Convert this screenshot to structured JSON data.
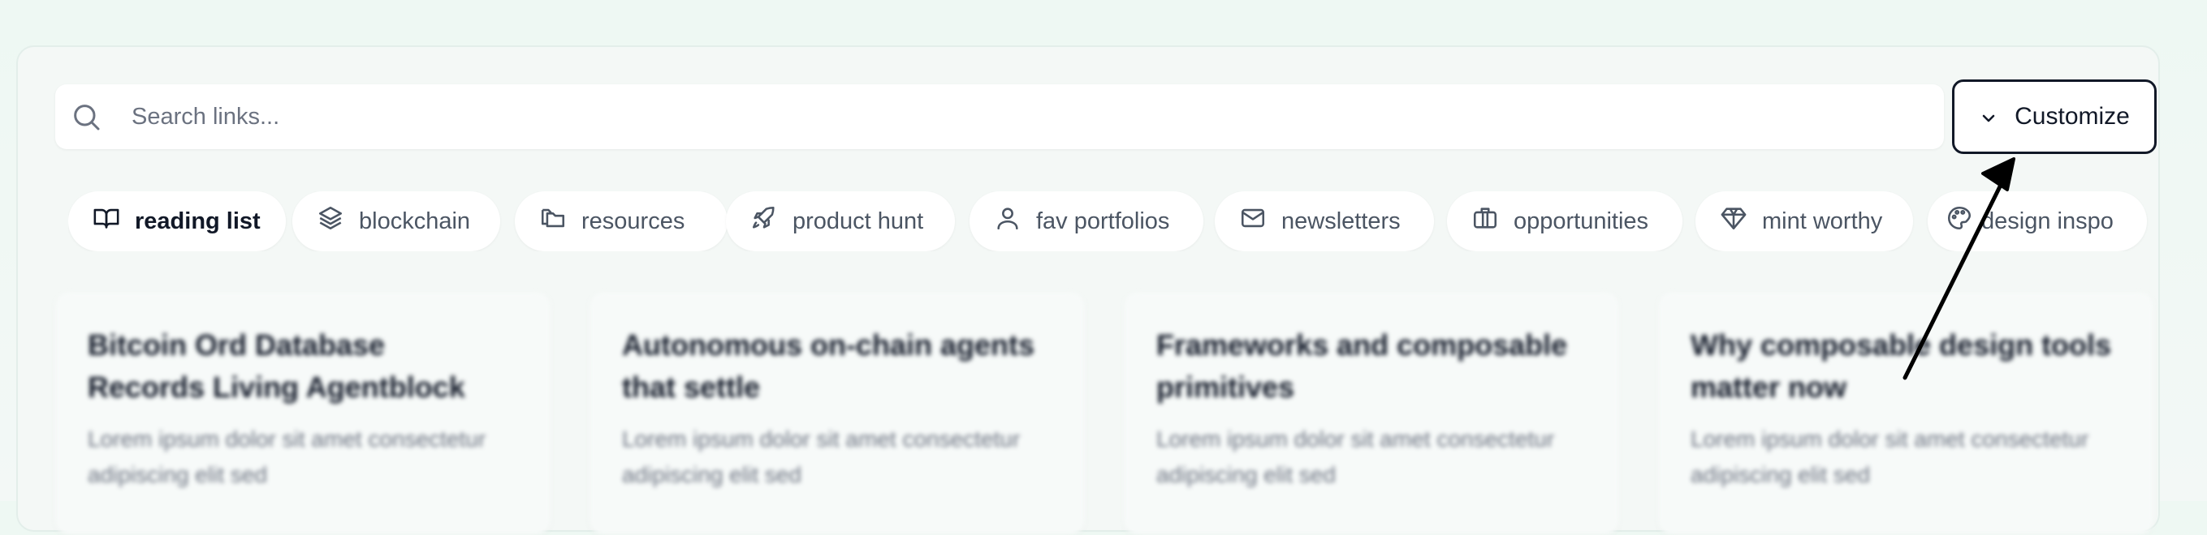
{
  "search": {
    "placeholder": "Search links...",
    "value": ""
  },
  "customize_button": {
    "label": "Customize",
    "icon": "chevron-down-icon"
  },
  "categories": [
    {
      "label": "reading list",
      "icon": "book-open-icon",
      "active": true
    },
    {
      "label": "blockchain",
      "icon": "layers-icon",
      "active": false
    },
    {
      "label": "resources",
      "icon": "folders-icon",
      "active": false
    },
    {
      "label": "product hunt",
      "icon": "rocket-icon",
      "active": false
    },
    {
      "label": "fav portfolios",
      "icon": "user-icon",
      "active": false
    },
    {
      "label": "newsletters",
      "icon": "mail-icon",
      "active": false
    },
    {
      "label": "opportunities",
      "icon": "briefcase-icon",
      "active": false
    },
    {
      "label": "mint worthy",
      "icon": "gem-icon",
      "active": false
    },
    {
      "label": "design inspo",
      "icon": "palette-icon",
      "active": false
    }
  ],
  "cards": [
    {
      "title": "Bitcoin Ord Database Records Living Agentblock",
      "description": "Lorem ipsum dolor sit amet consectetur adipiscing elit sed"
    },
    {
      "title": "Autonomous on-chain agents that settle",
      "description": "Lorem ipsum dolor sit amet consectetur adipiscing elit sed"
    },
    {
      "title": "Frameworks and composable primitives",
      "description": "Lorem ipsum dolor sit amet consectetur adipiscing elit sed"
    },
    {
      "title": "Why composable design tools matter now",
      "description": "Lorem ipsum dolor sit amet consectetur adipiscing elit sed"
    }
  ],
  "colors": {
    "accent": "#111827",
    "muted": "#4b5563",
    "background": "#eef8f3"
  }
}
